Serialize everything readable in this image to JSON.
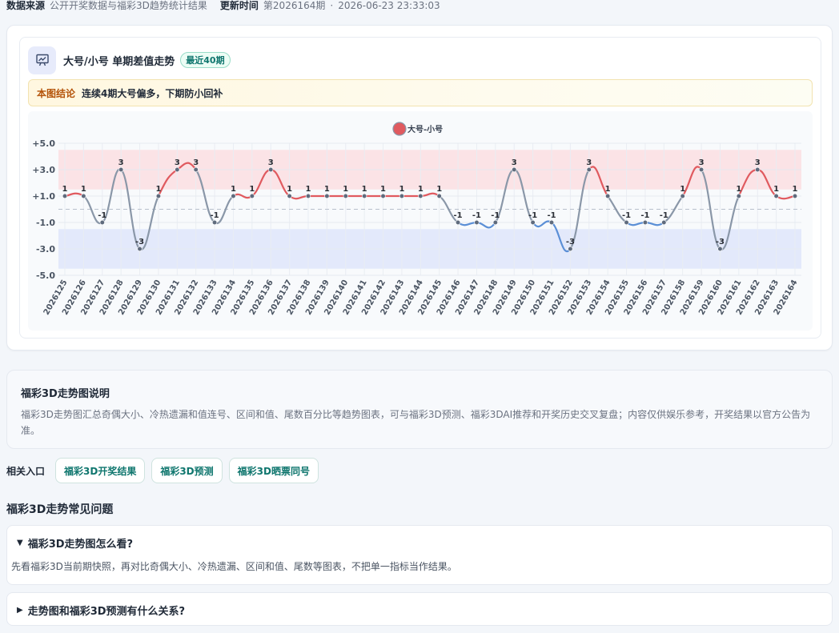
{
  "meta": {
    "source_label": "数据来源",
    "source_value": "公开开奖数据与福彩3D趋势统计结果",
    "update_label": "更新时间",
    "update_issue": "第2026164期",
    "separator": "·",
    "update_time": "2026-06-23 23:33:03"
  },
  "chart_card": {
    "icon": "presentation-chart-icon",
    "title": "大号/小号 单期差值走势",
    "badge": "最近40期",
    "conclusion_label": "本图结论",
    "conclusion_text": "连续4期大号偏多，下期防小回补"
  },
  "chart_data": {
    "type": "line",
    "legend": "大号-小号",
    "legend_color": "#e05a5f",
    "up_color": "#e05a5f",
    "down_color": "#5b8fd6",
    "neutral_color": "#8a97a8",
    "ylim": [
      -5,
      5
    ],
    "yticks": [
      "+5.0",
      "+3.0",
      "+1.0",
      "-1.0",
      "-3.0",
      "-5.0"
    ],
    "x": [
      "2026125",
      "2026126",
      "2026127",
      "2026128",
      "2026129",
      "2026130",
      "2026131",
      "2026132",
      "2026133",
      "2026134",
      "2026135",
      "2026136",
      "2026137",
      "2026138",
      "2026139",
      "2026140",
      "2026141",
      "2026142",
      "2026143",
      "2026144",
      "2026145",
      "2026146",
      "2026147",
      "2026148",
      "2026149",
      "2026150",
      "2026151",
      "2026152",
      "2026153",
      "2026154",
      "2026155",
      "2026156",
      "2026157",
      "2026158",
      "2026159",
      "2026160",
      "2026161",
      "2026162",
      "2026163",
      "2026164"
    ],
    "values": [
      1,
      1,
      -1,
      3,
      -3,
      1,
      3,
      3,
      -1,
      1,
      1,
      3,
      1,
      1,
      1,
      1,
      1,
      1,
      1,
      1,
      1,
      -1,
      -1,
      -1,
      3,
      -1,
      -1,
      -3,
      3,
      1,
      -1,
      -1,
      -1,
      1,
      3,
      -3,
      1,
      3,
      1,
      1
    ],
    "bands": [
      {
        "from": 1.5,
        "to": 4.5,
        "color": "#fbe3e6"
      },
      {
        "from": -4.5,
        "to": -1.5,
        "color": "#e3e9fb"
      }
    ],
    "zero_line": true
  },
  "description": {
    "title": "福彩3D走势图说明",
    "text": "福彩3D走势图汇总奇偶大小、冷热遗漏和值连号、区间和值、尾数百分比等趋势图表，可与福彩3D预测、福彩3DAI推荐和开奖历史交叉复盘；内容仅供娱乐参考，开奖结果以官方公告为准。"
  },
  "related": {
    "label": "相关入口",
    "links": [
      "福彩3D开奖结果",
      "福彩3D预测",
      "福彩3D晒票同号"
    ]
  },
  "faq": {
    "title": "福彩3D走势常见问题",
    "items": [
      {
        "question": "福彩3D走势图怎么看?",
        "answer": "先看福彩3D当前期快照，再对比奇偶大小、冷热遗漏、区间和值、尾数等图表，不把单一指标当作结果。",
        "open_marker": "▼"
      },
      {
        "question": "走势图和福彩3D预测有什么关系?",
        "closed_marker": "▶"
      }
    ]
  }
}
